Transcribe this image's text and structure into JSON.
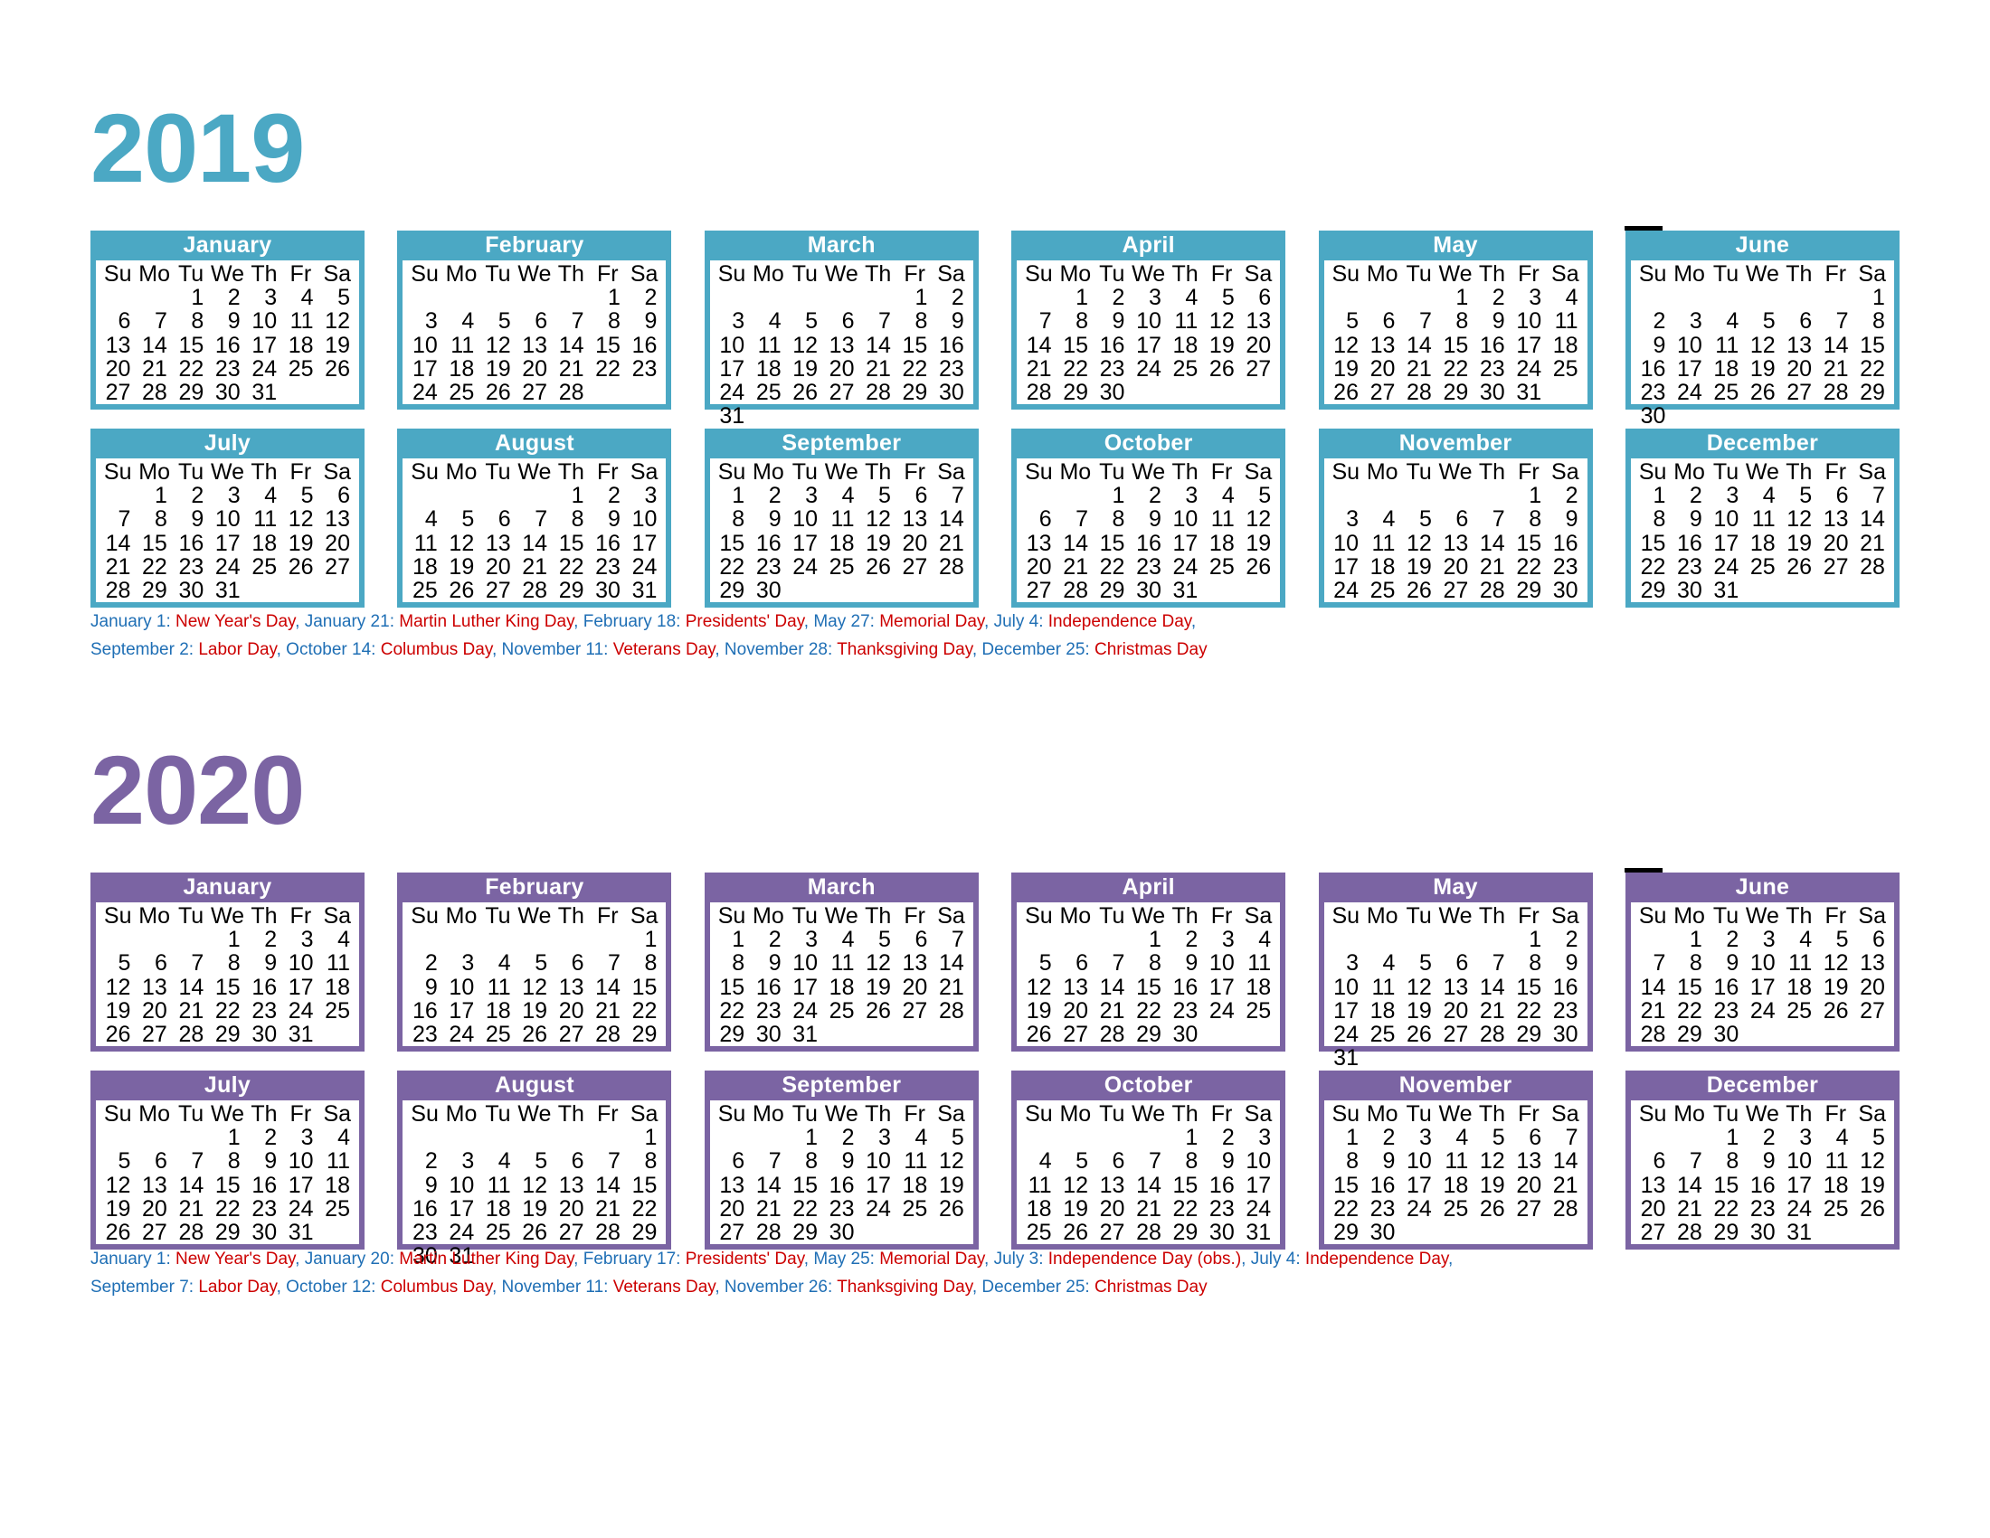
{
  "theme": {
    "teal": "#4BA8C4",
    "purple": "#7B64A3",
    "holiday_date_color": "#1F6FB5",
    "holiday_name_color": "#CC0000"
  },
  "dow": [
    "Su",
    "Mo",
    "Tu",
    "We",
    "Th",
    "Fr",
    "Sa"
  ],
  "years": [
    {
      "id": "2019",
      "title": "2019",
      "accent": "#4BA8C4",
      "months": [
        {
          "name": "January",
          "start": 2,
          "days": 31
        },
        {
          "name": "February",
          "start": 5,
          "days": 28
        },
        {
          "name": "March",
          "start": 5,
          "days": 31
        },
        {
          "name": "April",
          "start": 1,
          "days": 30
        },
        {
          "name": "May",
          "start": 3,
          "days": 31
        },
        {
          "name": "June",
          "start": 6,
          "days": 30
        },
        {
          "name": "July",
          "start": 1,
          "days": 31
        },
        {
          "name": "August",
          "start": 4,
          "days": 31
        },
        {
          "name": "September",
          "start": 0,
          "days": 30
        },
        {
          "name": "October",
          "start": 2,
          "days": 31
        },
        {
          "name": "November",
          "start": 5,
          "days": 30
        },
        {
          "name": "December",
          "start": 0,
          "days": 31
        }
      ],
      "holidays": [
        [
          {
            "date": "January 1",
            "name": "New Year's Day"
          },
          {
            "date": "January 21",
            "name": "Martin Luther King Day"
          },
          {
            "date": "February 18",
            "name": "Presidents' Day"
          },
          {
            "date": "May 27",
            "name": "Memorial Day"
          },
          {
            "date": "July 4",
            "name": "Independence Day"
          }
        ],
        [
          {
            "date": "September 2",
            "name": "Labor Day"
          },
          {
            "date": "October 14",
            "name": "Columbus Day"
          },
          {
            "date": "November 11",
            "name": "Veterans Day"
          },
          {
            "date": "November 28",
            "name": "Thanksgiving Day"
          },
          {
            "date": "December 25",
            "name": "Christmas Day"
          }
        ]
      ],
      "holiday_line_trailing_comma": [
        true,
        false
      ]
    },
    {
      "id": "2020",
      "title": "2020",
      "accent": "#7B64A3",
      "months": [
        {
          "name": "January",
          "start": 3,
          "days": 31
        },
        {
          "name": "February",
          "start": 6,
          "days": 29
        },
        {
          "name": "March",
          "start": 0,
          "days": 31
        },
        {
          "name": "April",
          "start": 3,
          "days": 30
        },
        {
          "name": "May",
          "start": 5,
          "days": 31
        },
        {
          "name": "June",
          "start": 1,
          "days": 30
        },
        {
          "name": "July",
          "start": 3,
          "days": 31
        },
        {
          "name": "August",
          "start": 6,
          "days": 31
        },
        {
          "name": "September",
          "start": 2,
          "days": 30
        },
        {
          "name": "October",
          "start": 4,
          "days": 31
        },
        {
          "name": "November",
          "start": 0,
          "days": 30
        },
        {
          "name": "December",
          "start": 2,
          "days": 31
        }
      ],
      "holidays": [
        [
          {
            "date": "January 1",
            "name": "New Year's Day"
          },
          {
            "date": "January 20",
            "name": "Martin Luther King Day"
          },
          {
            "date": "February 17",
            "name": "Presidents' Day"
          },
          {
            "date": "May 25",
            "name": "Memorial Day"
          },
          {
            "date": "July 3",
            "name": "Independence Day (obs.)"
          },
          {
            "date": "July 4",
            "name": "Independence Day"
          }
        ],
        [
          {
            "date": "September 7",
            "name": "Labor Day"
          },
          {
            "date": "October 12",
            "name": "Columbus Day"
          },
          {
            "date": "November 11",
            "name": "Veterans Day"
          },
          {
            "date": "November 26",
            "name": "Thanksgiving Day"
          },
          {
            "date": "December 25",
            "name": "Christmas Day"
          }
        ]
      ],
      "holiday_line_trailing_comma": [
        true,
        false
      ]
    }
  ]
}
